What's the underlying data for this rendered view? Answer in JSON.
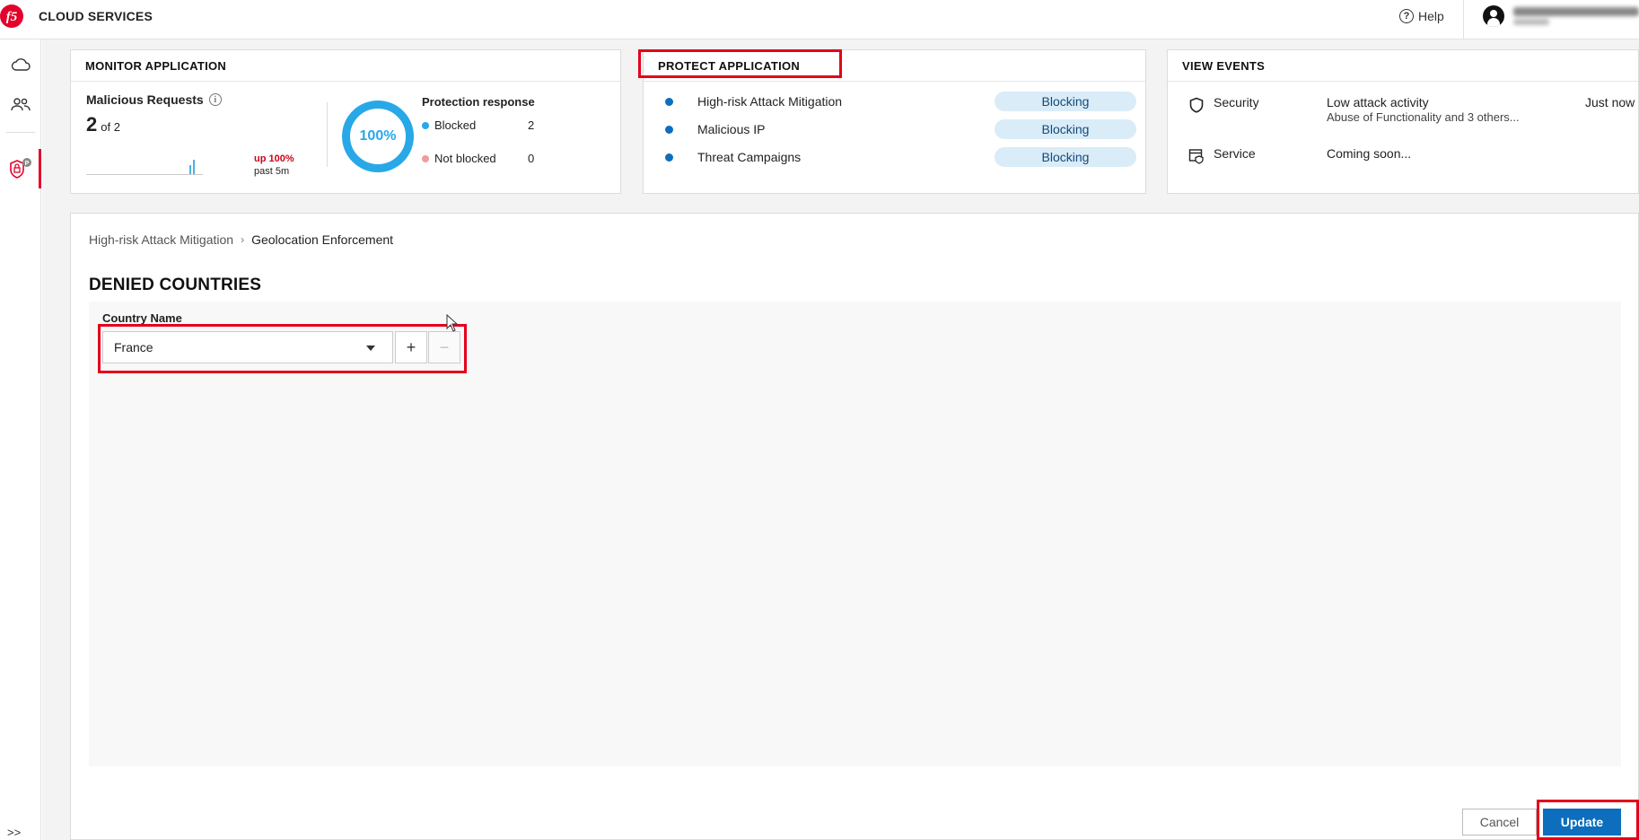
{
  "app": {
    "brand": "CLOUD SERVICES",
    "logo_text": "f5",
    "help_label": "Help"
  },
  "monitor": {
    "title": "MONITOR APPLICATION",
    "malicious_label": "Malicious Requests",
    "count": "2",
    "of_total": "of 2",
    "change": "up 100%",
    "period": "past 5m",
    "donut_percent": "100%",
    "response_title": "Protection response",
    "blocked_label": "Blocked",
    "blocked_value": "2",
    "not_blocked_label": "Not blocked",
    "not_blocked_value": "0",
    "colors": {
      "blocked": "#29a8e8",
      "not_blocked": "#f29b9b"
    }
  },
  "protect": {
    "title": "PROTECT APPLICATION",
    "items": [
      {
        "name": "High-risk Attack Mitigation",
        "status": "Blocking"
      },
      {
        "name": "Malicious IP",
        "status": "Blocking"
      },
      {
        "name": "Threat Campaigns",
        "status": "Blocking"
      }
    ]
  },
  "events": {
    "title": "VIEW EVENTS",
    "security_label": "Security",
    "security_text": "Low attack activity",
    "security_sub": "Abuse of Functionality and 3 others...",
    "security_time": "Just now",
    "service_label": "Service",
    "service_text": "Coming soon..."
  },
  "main": {
    "breadcrumb_parent": "High-risk Attack Mitigation",
    "breadcrumb_current": "Geolocation Enforcement",
    "section_title": "DENIED COUNTRIES",
    "column_label": "Country Name",
    "country_value": "France",
    "add_symbol": "+",
    "remove_symbol": "−",
    "cancel_label": "Cancel",
    "update_label": "Update"
  },
  "rail": {
    "expand_label": ">>"
  },
  "colors": {
    "accent": "#0c6ebd",
    "brand_red": "#e4002b",
    "annotation": "#e4001b"
  }
}
